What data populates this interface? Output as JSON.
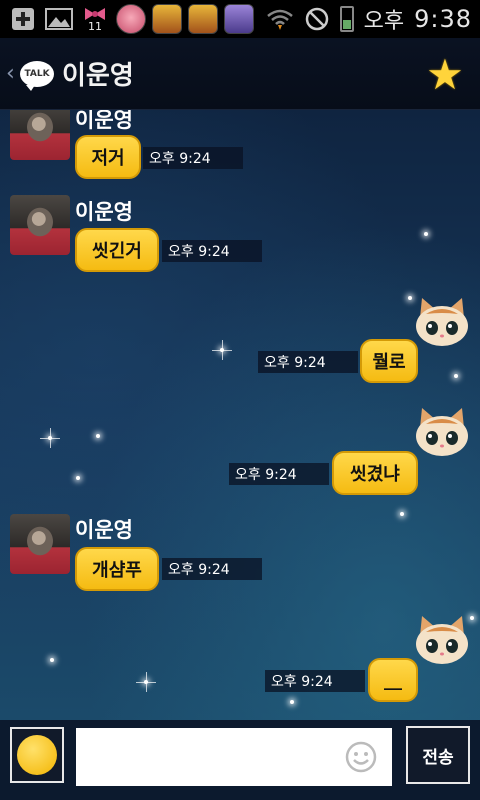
{
  "status_bar": {
    "notification_count": "11",
    "ampm": "오후",
    "time": "9:38"
  },
  "header": {
    "badge": "TALK",
    "title": "이운영"
  },
  "messages": [
    {
      "sender": "이운영",
      "text": "저거",
      "time": "오후 9:24"
    },
    {
      "sender": "이운영",
      "text": "씻긴거",
      "time": "오후 9:24"
    },
    {
      "sender": "me",
      "text": "뭘로",
      "time": "오후 9:24"
    },
    {
      "sender": "me",
      "text": "씻겼냐",
      "time": "오후 9:24"
    },
    {
      "sender": "이운영",
      "text": "개샴푸",
      "time": "오후 9:24"
    },
    {
      "sender": "me",
      "text": "__",
      "time": "오후 9:24"
    }
  ],
  "input": {
    "value": "",
    "send_label": "전송"
  },
  "icons": {
    "back": "chevron-left-icon",
    "favorite": "star-icon",
    "emoticon": "smile-icon"
  },
  "colors": {
    "bubble": "#f5bb12",
    "header_bg": "#0a1222",
    "accent_star": "#ffd43b"
  }
}
